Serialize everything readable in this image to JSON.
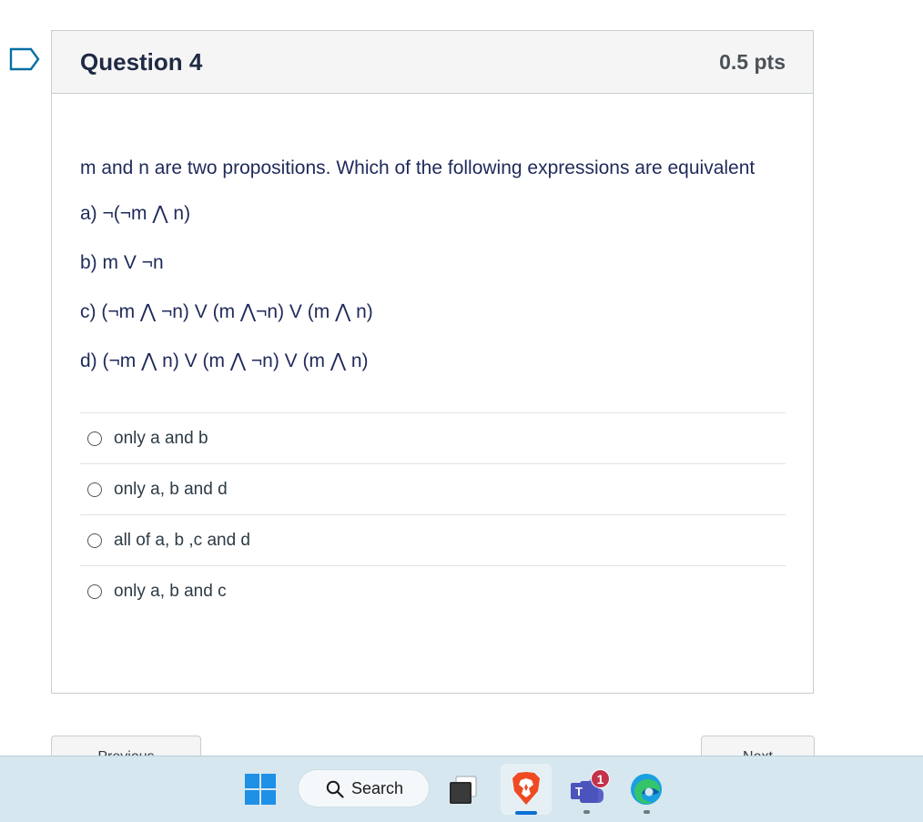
{
  "question": {
    "title": "Question 4",
    "points": "0.5 pts",
    "text": "m and n are two propositions. Which of the following expressions are equivalent",
    "expressions": [
      "a) ¬(¬m ⋀ n)",
      "b) m V ¬n",
      "c) (¬m ⋀ ¬n) V (m ⋀¬n) V (m ⋀ n)",
      "d) (¬m ⋀ n) V (m ⋀ ¬n) V (m ⋀ n)"
    ],
    "answers": [
      "only a and b",
      "only a, b and d",
      "all of a, b ,c and d",
      "only a, b and c"
    ]
  },
  "navigation": {
    "previous_label": "Previous",
    "next_label": "Next"
  },
  "taskbar": {
    "search_label": "Search",
    "teams_badge": "1"
  },
  "colors": {
    "question_text": "#1f2a5a",
    "header_bg": "#f5f5f5",
    "flag_outline": "#0770a3",
    "taskbar_bg": "#d6e7ef"
  }
}
